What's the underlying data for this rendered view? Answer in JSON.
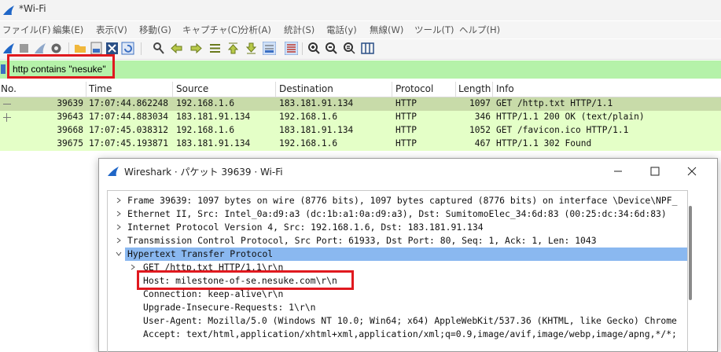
{
  "window": {
    "title": "*Wi-Fi"
  },
  "menu": [
    "ファイル(F)",
    "編集(E)",
    "表示(V)",
    "移動(G)",
    "キャプチャ(C)",
    "分析(A)",
    "統計(S)",
    "電話(y)",
    "無線(W)",
    "ツール(T)",
    "ヘルプ(H)"
  ],
  "filter": {
    "value": "http contains \"nesuke\""
  },
  "columns": [
    "No.",
    "Time",
    "Source",
    "Destination",
    "Protocol",
    "Length",
    "Info"
  ],
  "packets": [
    {
      "no": "39639",
      "time": "17:07:44.862248",
      "source": "192.168.1.6",
      "destination": "183.181.91.134",
      "protocol": "HTTP",
      "length": "1097",
      "info": "GET /http.txt HTTP/1.1"
    },
    {
      "no": "39643",
      "time": "17:07:44.883034",
      "source": "183.181.91.134",
      "destination": "192.168.1.6",
      "protocol": "HTTP",
      "length": "346",
      "info": "HTTP/1.1 200 OK  (text/plain)"
    },
    {
      "no": "39668",
      "time": "17:07:45.038312",
      "source": "192.168.1.6",
      "destination": "183.181.91.134",
      "protocol": "HTTP",
      "length": "1052",
      "info": "GET /favicon.ico HTTP/1.1"
    },
    {
      "no": "39675",
      "time": "17:07:45.193871",
      "source": "183.181.91.134",
      "destination": "192.168.1.6",
      "protocol": "HTTP",
      "length": "467",
      "info": "HTTP/1.1 302 Found"
    }
  ],
  "dialog": {
    "title": "Wireshark · パケット 39639 · Wi-Fi",
    "tree": [
      "Frame 39639: 1097 bytes on wire (8776 bits), 1097 bytes captured (8776 bits) on interface \\Device\\NPF_",
      "Ethernet II, Src: Intel_0a:d9:a3 (dc:1b:a1:0a:d9:a3), Dst: SumitomoElec_34:6d:83 (00:25:dc:34:6d:83)",
      "Internet Protocol Version 4, Src: 192.168.1.6, Dst: 183.181.91.134",
      "Transmission Control Protocol, Src Port: 61933, Dst Port: 80, Seq: 1, Ack: 1, Len: 1043",
      "Hypertext Transfer Protocol",
      "GET /http.txt HTTP/1.1\\r\\n",
      "Host: milestone-of-se.nesuke.com\\r\\n",
      "Connection: keep-alive\\r\\n",
      "Upgrade-Insecure-Requests: 1\\r\\n",
      "User-Agent: Mozilla/5.0 (Windows NT 10.0; Win64; x64) AppleWebKit/537.36 (KHTML, like Gecko) Chrome",
      "Accept: text/html,application/xhtml+xml,application/xml;q=0.9,image/avif,image/webp,image/apng,*/*;"
    ]
  },
  "colors": {
    "filter_bg": "#b5f2a9",
    "http_row": "#e4ffc7",
    "selected_row": "#c8dba9",
    "tree_selected": "#8ab8f0",
    "highlight": "#e0191f"
  }
}
